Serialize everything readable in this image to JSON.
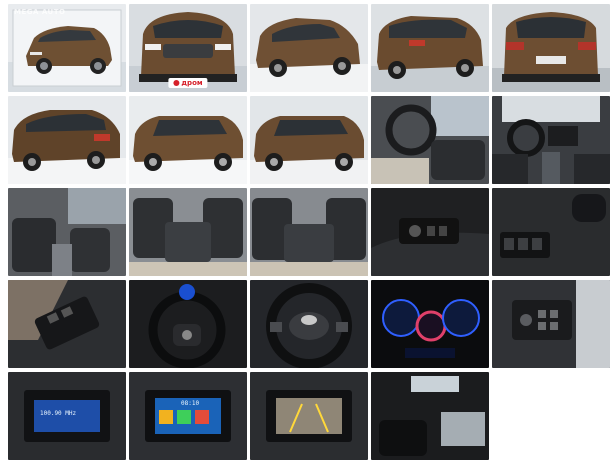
{
  "gallery": {
    "watermark": "MEGA AUTO",
    "source_badge": "дром",
    "radio_readout": "100.90 MHz",
    "clock_readout": "08:10",
    "tiles": [
      {
        "id": "photo-1",
        "subject": "exterior-front-three-quarter"
      },
      {
        "id": "photo-2",
        "subject": "exterior-front"
      },
      {
        "id": "photo-3",
        "subject": "exterior-front-left"
      },
      {
        "id": "photo-4",
        "subject": "exterior-rear-three-quarter"
      },
      {
        "id": "photo-5",
        "subject": "exterior-rear"
      },
      {
        "id": "photo-6",
        "subject": "exterior-rear-left"
      },
      {
        "id": "photo-7",
        "subject": "exterior-side-right"
      },
      {
        "id": "photo-8",
        "subject": "exterior-side-right-alt"
      },
      {
        "id": "photo-9",
        "subject": "interior-driver-seat"
      },
      {
        "id": "photo-10",
        "subject": "interior-dashboard"
      },
      {
        "id": "photo-11",
        "subject": "interior-front-seats"
      },
      {
        "id": "photo-12",
        "subject": "interior-rear-seats"
      },
      {
        "id": "photo-13",
        "subject": "interior-rear-seats-alt"
      },
      {
        "id": "photo-14",
        "subject": "door-window-switches"
      },
      {
        "id": "photo-15",
        "subject": "dashboard-switches"
      },
      {
        "id": "photo-16",
        "subject": "door-panel-switches"
      },
      {
        "id": "photo-17",
        "subject": "steering-wheel-gauges"
      },
      {
        "id": "photo-18",
        "subject": "steering-wheel-logo"
      },
      {
        "id": "photo-19",
        "subject": "instrument-cluster"
      },
      {
        "id": "photo-20",
        "subject": "center-console-buttons"
      },
      {
        "id": "photo-21",
        "subject": "head-unit-radio"
      },
      {
        "id": "photo-22",
        "subject": "head-unit-menu"
      },
      {
        "id": "photo-23",
        "subject": "head-unit-rear-camera"
      },
      {
        "id": "photo-24",
        "subject": "interior-rear-view"
      }
    ]
  }
}
